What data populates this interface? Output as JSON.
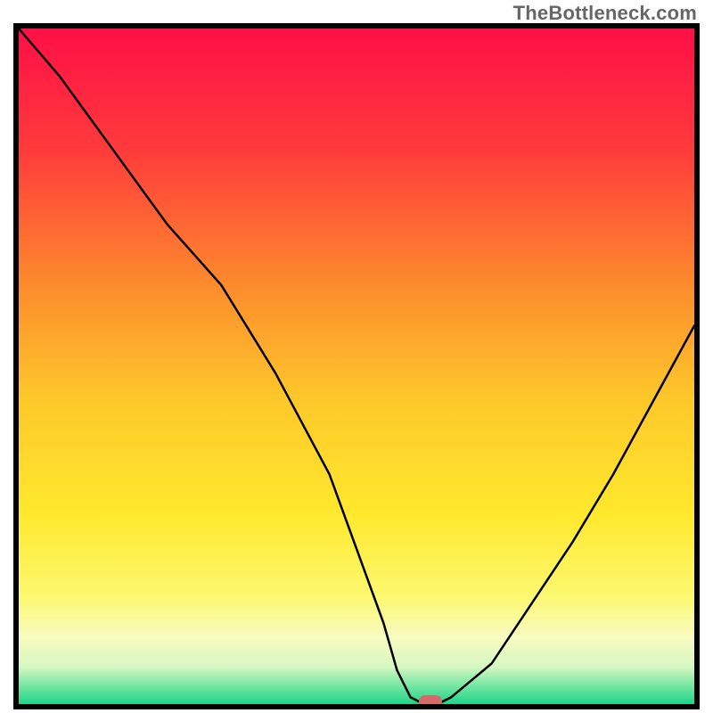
{
  "watermark": "TheBottleneck.com",
  "chart_data": {
    "type": "line",
    "title": "",
    "xlabel": "",
    "ylabel": "",
    "xlim": [
      0,
      100
    ],
    "ylim": [
      0,
      100
    ],
    "series": [
      {
        "name": "bottleneck-curve",
        "x": [
          0,
          6,
          14,
          22,
          30,
          38,
          46,
          54,
          56,
          58,
          60,
          62,
          64,
          70,
          76,
          82,
          88,
          94,
          100
        ],
        "values": [
          100,
          93,
          82,
          71,
          62,
          49,
          34,
          12,
          5,
          1,
          0,
          0,
          1,
          6,
          15,
          24,
          34,
          45,
          56
        ]
      }
    ],
    "marker": {
      "x": 61,
      "y": 0
    },
    "background": {
      "stops": [
        {
          "offset": 0,
          "color": "#ff0f47"
        },
        {
          "offset": 0.18,
          "color": "#ff3b3b"
        },
        {
          "offset": 0.38,
          "color": "#fd8b2d"
        },
        {
          "offset": 0.55,
          "color": "#fdc82a"
        },
        {
          "offset": 0.72,
          "color": "#ffe92d"
        },
        {
          "offset": 0.84,
          "color": "#fcf86f"
        },
        {
          "offset": 0.9,
          "color": "#f8fbc0"
        },
        {
          "offset": 0.945,
          "color": "#d6f7c2"
        },
        {
          "offset": 0.97,
          "color": "#7fe9a6"
        },
        {
          "offset": 1.0,
          "color": "#1fd489"
        }
      ]
    }
  }
}
